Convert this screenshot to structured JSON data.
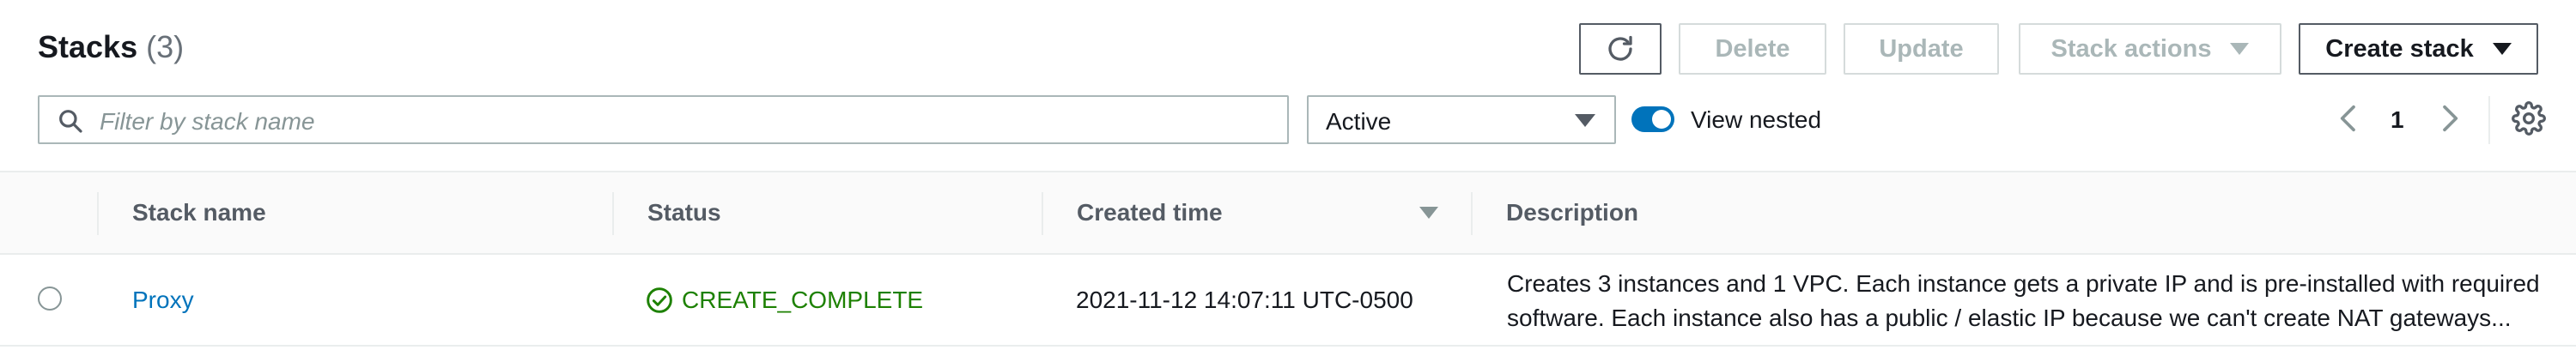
{
  "header": {
    "title": "Stacks",
    "count": "(3)"
  },
  "toolbar": {
    "refresh_icon": "refresh-icon",
    "delete_label": "Delete",
    "update_label": "Update",
    "stack_actions_label": "Stack actions",
    "create_stack_label": "Create stack"
  },
  "filter": {
    "search_placeholder": "Filter by stack name",
    "search_value": "",
    "status_selected": "Active",
    "view_nested_label": "View nested",
    "view_nested_on": true
  },
  "pagination": {
    "current_page": "1"
  },
  "table": {
    "columns": [
      "Stack name",
      "Status",
      "Created time",
      "Description"
    ],
    "sorted_column": "Created time",
    "rows": [
      {
        "stack_name": "Proxy",
        "status": "CREATE_COMPLETE",
        "created_time": "2021-11-12 14:07:11 UTC-0500",
        "description_line1": "Creates 3 instances and 1 VPC. Each instance gets a private IP and is pre-installed with required",
        "description_line2": "software. Each instance also has a public / elastic IP because we can't create NAT gateways..."
      }
    ]
  },
  "colors": {
    "link": "#0073bb",
    "success": "#1d8102",
    "toggle_on": "#0073bb",
    "disabled_text": "#aab7b8"
  }
}
